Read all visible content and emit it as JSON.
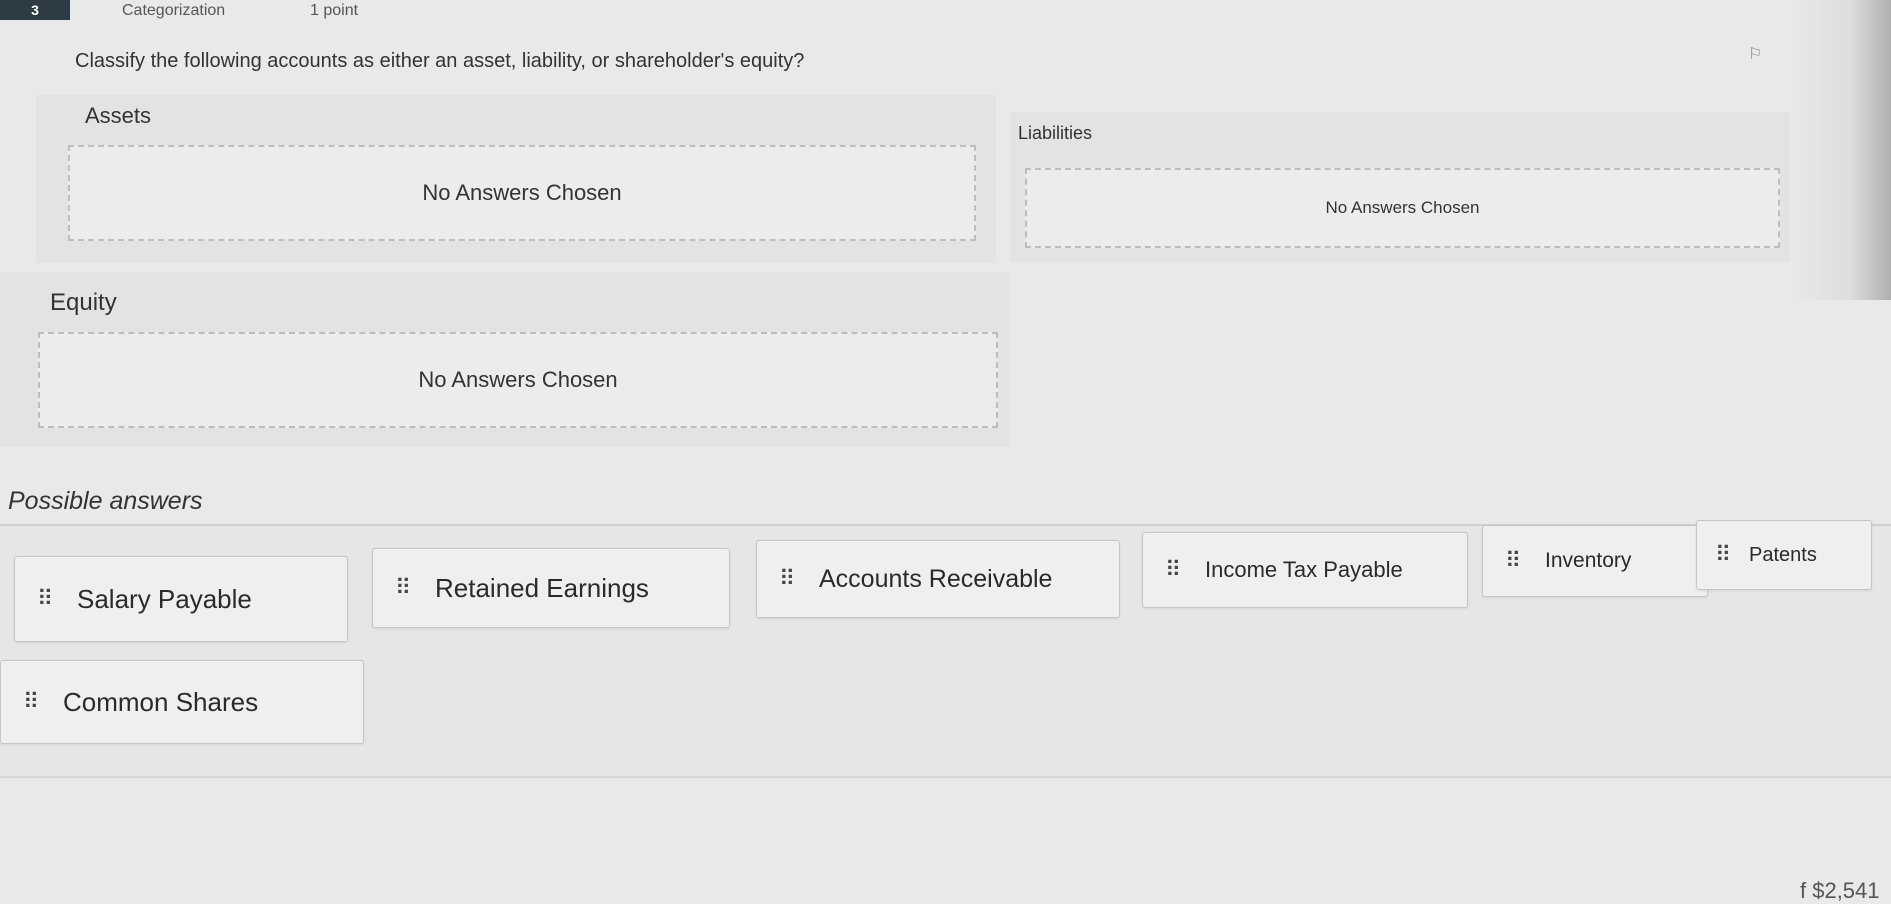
{
  "question": {
    "number": "3",
    "type": "Categorization",
    "points": "1 point",
    "prompt": "Classify the following accounts as either an asset, liability, or shareholder's equity?"
  },
  "categories": [
    {
      "label": "Assets",
      "drop_text": "No Answers Chosen"
    },
    {
      "label": "Liabilities",
      "drop_text": "No Answers Chosen"
    },
    {
      "label": "Equity",
      "drop_text": "No Answers Chosen"
    }
  ],
  "possible_answers": {
    "title": "Possible answers",
    "items": [
      {
        "label": "Salary Payable"
      },
      {
        "label": "Retained Earnings"
      },
      {
        "label": "Accounts Receivable"
      },
      {
        "label": "Income Tax Payable"
      },
      {
        "label": "Inventory"
      },
      {
        "label": "Patents"
      },
      {
        "label": "Common Shares"
      }
    ]
  },
  "icons": {
    "drag_handle": "drag-handle-icon",
    "flag": "flag-icon"
  },
  "corner_text": "f $2,541",
  "colors": {
    "question_number_bg": "#2d3b45",
    "background": "#e9e9e9"
  }
}
